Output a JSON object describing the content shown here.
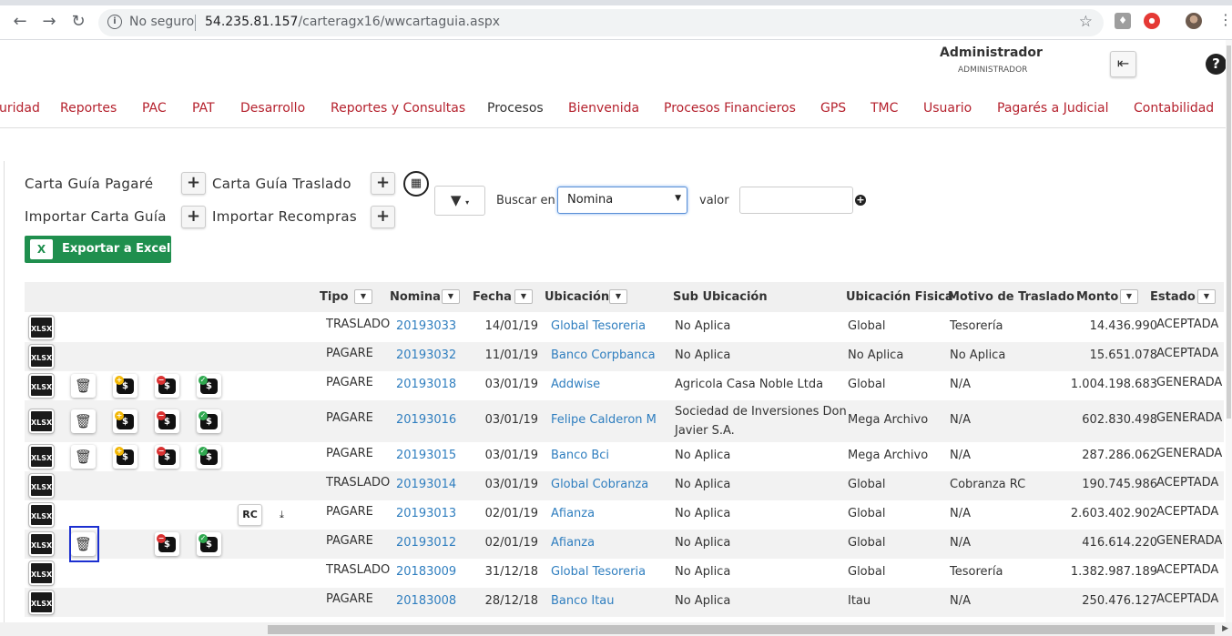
{
  "browser": {
    "security_label": "No seguro",
    "url_host": "54.235.81.157",
    "url_path": "/carteragx16/wwcartaguia.aspx"
  },
  "header": {
    "user_name": "Administrador",
    "user_role": "ADMINISTRADOR"
  },
  "menu": [
    "uridad",
    "Reportes",
    "PAC",
    "PAT",
    "Desarrollo",
    "Reportes y Consultas",
    "Procesos",
    "Bienvenida",
    "Procesos Financieros",
    "GPS",
    "TMC",
    "Usuario",
    "Pagarés a Judicial",
    "Contabilidad"
  ],
  "actions": {
    "carta_guia_pagare": "Carta Guía Pagaré",
    "carta_guia_traslado": "Carta Guía Traslado",
    "importar_carta_guia": "Importar Carta Guía",
    "importar_recompras": "Importar Recompras",
    "exportar_excel": "Exportar a Excel"
  },
  "search": {
    "buscar_en_label": "Buscar en",
    "selected_field": "Nomina",
    "valor_label": "valor",
    "valor_value": ""
  },
  "table": {
    "columns": {
      "tipo": "Tipo",
      "nomina": "Nomina",
      "fecha": "Fecha",
      "ubicacion": "Ubicación",
      "sub_ubicacion": "Sub Ubicación",
      "ubicacion_fisica": "Ubicación Fisica",
      "motivo": "Motivo de Traslado",
      "monto": "Monto",
      "estado": "Estado"
    },
    "rows": [
      {
        "tipo": "TRASLADO",
        "nomina": "20193033",
        "fecha": "14/01/19",
        "ubicacion": "Global Tesoreria",
        "sub_ubicacion": "No Aplica",
        "sub_ubicacion_2": "",
        "ubicacion_fisica": "Global",
        "motivo": "Tesorería",
        "monto": "14.436.990",
        "estado": "ACEPTADA"
      },
      {
        "tipo": "PAGARE",
        "nomina": "20193032",
        "fecha": "11/01/19",
        "ubicacion": "Banco Corpbanca",
        "sub_ubicacion": "No Aplica",
        "sub_ubicacion_2": "",
        "ubicacion_fisica": "No Aplica",
        "motivo": "No Aplica",
        "monto": "15.651.078",
        "estado": "ACEPTADA"
      },
      {
        "tipo": "PAGARE",
        "nomina": "20193018",
        "fecha": "03/01/19",
        "ubicacion": "Addwise",
        "sub_ubicacion": "Agricola Casa Noble Ltda",
        "sub_ubicacion_2": "",
        "ubicacion_fisica": "Global",
        "motivo": "N/A",
        "monto": "1.004.198.683",
        "estado": "GENERADA"
      },
      {
        "tipo": "PAGARE",
        "nomina": "20193016",
        "fecha": "03/01/19",
        "ubicacion": "Felipe Calderon M",
        "sub_ubicacion": "Sociedad de Inversiones Don",
        "sub_ubicacion_2": "Javier S.A.",
        "ubicacion_fisica": "Mega Archivo",
        "motivo": "N/A",
        "monto": "602.830.498",
        "estado": "GENERADA"
      },
      {
        "tipo": "PAGARE",
        "nomina": "20193015",
        "fecha": "03/01/19",
        "ubicacion": "Banco Bci",
        "sub_ubicacion": "No Aplica",
        "sub_ubicacion_2": "",
        "ubicacion_fisica": "Mega Archivo",
        "motivo": "N/A",
        "monto": "287.286.062",
        "estado": "GENERADA"
      },
      {
        "tipo": "TRASLADO",
        "nomina": "20193014",
        "fecha": "03/01/19",
        "ubicacion": "Global Cobranza",
        "sub_ubicacion": "No Aplica",
        "sub_ubicacion_2": "",
        "ubicacion_fisica": "Global",
        "motivo": "Cobranza RC",
        "monto": "190.745.986",
        "estado": "ACEPTADA"
      },
      {
        "tipo": "PAGARE",
        "nomina": "20193013",
        "fecha": "02/01/19",
        "ubicacion": "Afianza",
        "sub_ubicacion": "No Aplica",
        "sub_ubicacion_2": "",
        "ubicacion_fisica": "Global",
        "motivo": "N/A",
        "monto": "2.603.402.902",
        "estado": "ACEPTADA"
      },
      {
        "tipo": "PAGARE",
        "nomina": "20193012",
        "fecha": "02/01/19",
        "ubicacion": "Afianza",
        "sub_ubicacion": "No Aplica",
        "sub_ubicacion_2": "",
        "ubicacion_fisica": "Global",
        "motivo": "N/A",
        "monto": "416.614.220",
        "estado": "GENERADA"
      },
      {
        "tipo": "TRASLADO",
        "nomina": "20183009",
        "fecha": "31/12/18",
        "ubicacion": "Global Tesoreria",
        "sub_ubicacion": "No Aplica",
        "sub_ubicacion_2": "",
        "ubicacion_fisica": "Global",
        "motivo": "Tesorería",
        "monto": "1.382.987.189",
        "estado": "ACEPTADA"
      },
      {
        "tipo": "PAGARE",
        "nomina": "20183008",
        "fecha": "28/12/18",
        "ubicacion": "Banco Itau",
        "sub_ubicacion": "No Aplica",
        "sub_ubicacion_2": "",
        "ubicacion_fisica": "Itau",
        "motivo": "N/A",
        "monto": "250.476.127",
        "estado": "ACEPTADA"
      }
    ],
    "xlsx_label": "XLSX",
    "rc_label": "RC"
  }
}
